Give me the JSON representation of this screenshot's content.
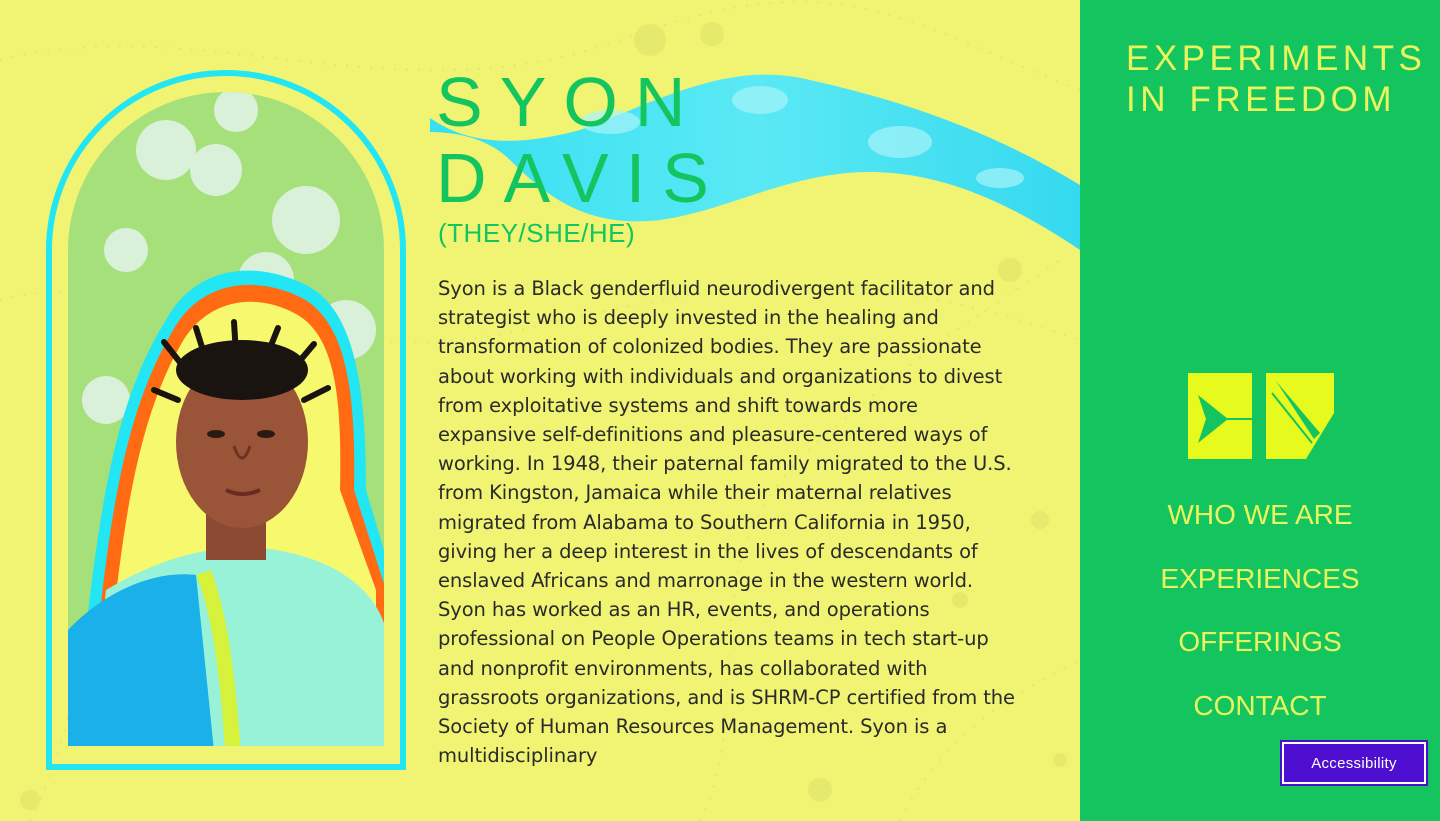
{
  "profile": {
    "first_name": "SYON",
    "last_name": "DAVIS",
    "pronouns": "(THEY/SHE/HE)",
    "bio": "Syon is a Black genderfluid neurodivergent facilitator and strategist who is deeply invested in the healing and transformation of colonized bodies. They are passionate about working with individuals and organizations to divest from exploitative systems and shift towards more expansive self-definitions and pleasure-centered ways of working. In 1948, their paternal family migrated to the U.S. from Kingston, Jamaica while their maternal relatives migrated from Alabama to Southern California in 1950, giving her a deep interest in the lives of descendants of enslaved Africans and marronage in the western world. Syon has worked as an HR, events, and operations professional on People Operations teams in tech start-up and nonprofit environments, has collaborated with grassroots organizations, and is SHRM-CP certified from the Society of Human Resources Management. Syon is a multidisciplinary"
  },
  "sidebar": {
    "brand_line1": "EXPERIMENTS",
    "brand_line2a": "IN",
    "brand_line2b": "FREEDOM",
    "nav": [
      {
        "label": "WHO WE ARE"
      },
      {
        "label": "EXPERIENCES"
      },
      {
        "label": "OFFERINGS"
      },
      {
        "label": "CONTACT"
      }
    ]
  },
  "accessibility_button": "Accessibility",
  "colors": {
    "background": "#f0f472",
    "sidebar": "#13c45f",
    "accent_text": "#eaf55e",
    "title_green": "#13c45f",
    "ribbon": "#3fe4f4",
    "accessibility_bg": "#4e0fd0"
  }
}
